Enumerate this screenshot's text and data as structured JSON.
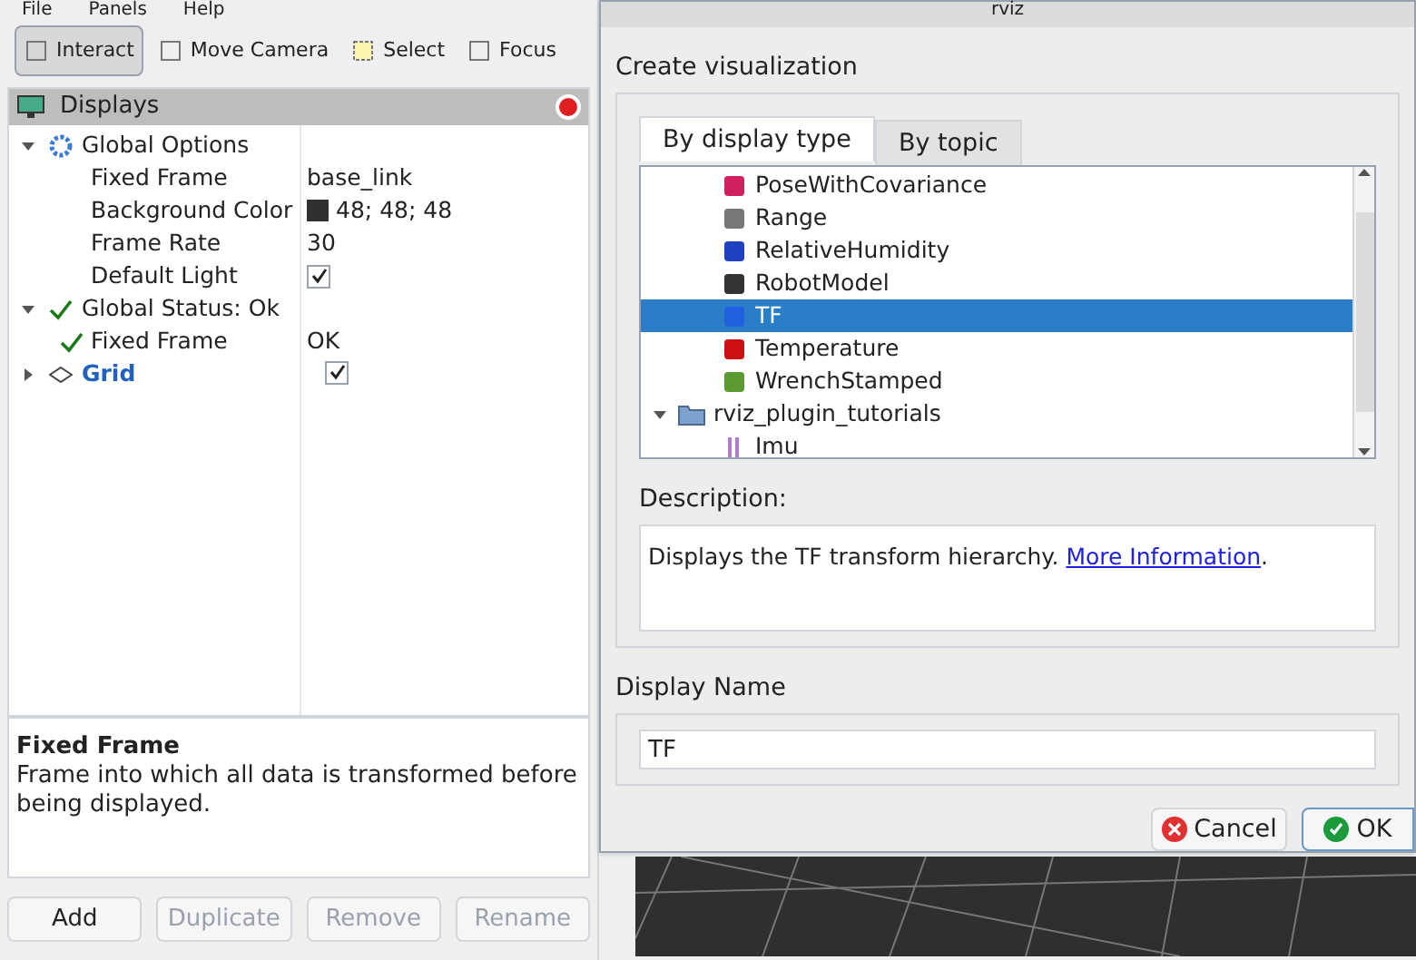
{
  "menu": [
    "File",
    "Panels",
    "Help"
  ],
  "toolbar": [
    {
      "label": "Interact",
      "selected": true
    },
    {
      "label": "Move Camera",
      "selected": false
    },
    {
      "label": "Select",
      "selected": false
    },
    {
      "label": "Focus",
      "selected": false
    }
  ],
  "displays_panel": {
    "title": "Displays",
    "tree": [
      {
        "label": "Global Options",
        "kind": "options",
        "expanded": true,
        "children": [
          {
            "label": "Fixed Frame",
            "kind": "text",
            "value": "base_link"
          },
          {
            "label": "Background Color",
            "kind": "color",
            "value": "48; 48; 48",
            "color": "#303030"
          },
          {
            "label": "Frame Rate",
            "kind": "text",
            "value": "30"
          },
          {
            "label": "Default Light",
            "kind": "checkbox",
            "checked": true
          }
        ]
      },
      {
        "label": "Global Status: Ok",
        "kind": "status",
        "expanded": true,
        "children": [
          {
            "label": "Fixed Frame",
            "kind": "status",
            "value": "OK"
          }
        ]
      },
      {
        "label": "Grid",
        "kind": "display",
        "expanded": false,
        "checked": true
      }
    ],
    "help": {
      "title": "Fixed Frame",
      "text": "Frame into which all data is transformed before being displayed."
    },
    "buttons": [
      {
        "label": "Add",
        "disabled": false
      },
      {
        "label": "Duplicate",
        "disabled": true
      },
      {
        "label": "Remove",
        "disabled": true
      },
      {
        "label": "Rename",
        "disabled": true
      }
    ]
  },
  "dialog": {
    "title": "rviz",
    "section": "Create visualization",
    "tabs": [
      {
        "label": "By display type",
        "selected": true
      },
      {
        "label": "By topic",
        "selected": false
      }
    ],
    "types": [
      {
        "label": "PoseWithCovariance",
        "kind": "display",
        "selected": false
      },
      {
        "label": "Range",
        "kind": "display",
        "selected": false
      },
      {
        "label": "RelativeHumidity",
        "kind": "display",
        "selected": false
      },
      {
        "label": "RobotModel",
        "kind": "display",
        "selected": false
      },
      {
        "label": "TF",
        "kind": "display",
        "selected": true
      },
      {
        "label": "Temperature",
        "kind": "display",
        "selected": false
      },
      {
        "label": "WrenchStamped",
        "kind": "display",
        "selected": false
      },
      {
        "label": "rviz_plugin_tutorials",
        "kind": "folder",
        "expanded": true,
        "children": [
          {
            "label": "Imu",
            "selected": false
          }
        ]
      }
    ],
    "description_label": "Description:",
    "description": "Displays the TF transform hierarchy.",
    "description_link": "More Information",
    "description_end": ".",
    "name_label": "Display Name",
    "name_value": "TF",
    "cancel": "Cancel",
    "ok": "OK"
  }
}
